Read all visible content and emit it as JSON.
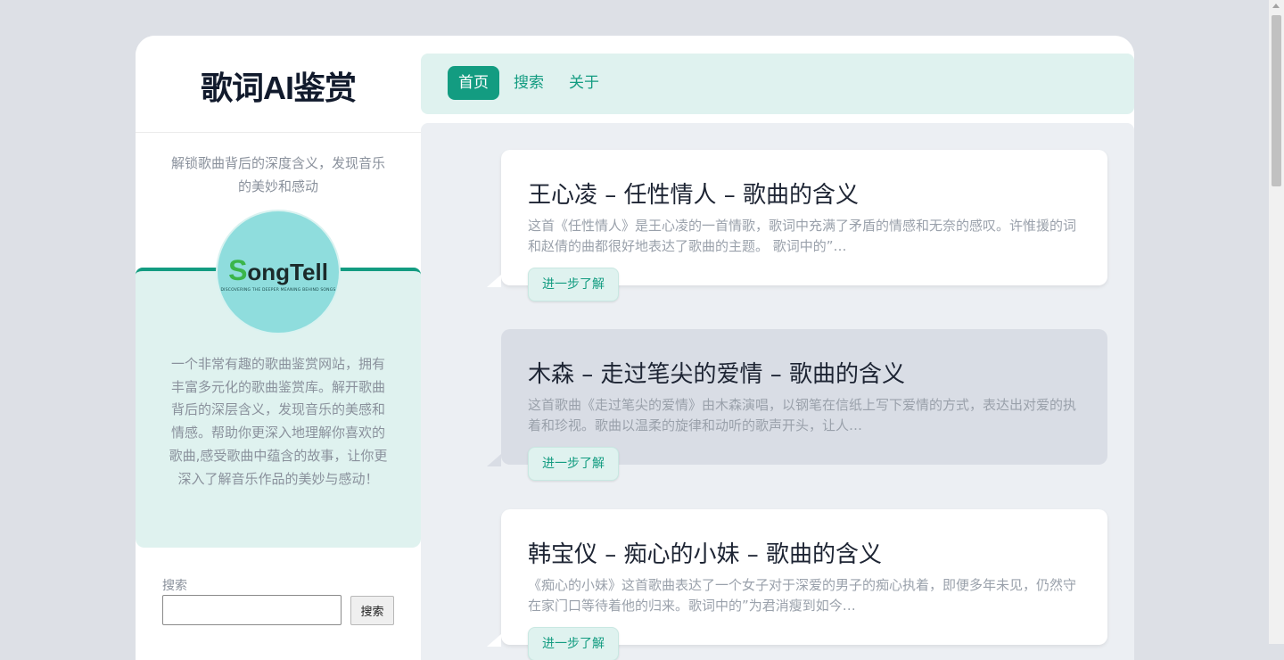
{
  "site": {
    "title": "歌词AI鉴赏",
    "tagline": "解锁歌曲背后的深度含义，发现音乐的美妙和感动",
    "logo_text": "SongTell",
    "logo_subtitle": "DISCOVERING THE DEEPER MEANING BEHIND SONGS",
    "intro": "一个非常有趣的歌曲鉴赏网站，拥有丰富多元化的歌曲鉴赏库。解开歌曲背后的深层含义，发现音乐的美感和情感。帮助你更深入地理解你喜欢的歌曲,感受歌曲中蕴含的故事，让你更深入了解音乐作品的美妙与感动！"
  },
  "search": {
    "label": "搜索",
    "input_value": "",
    "button_label": "搜索"
  },
  "nav": {
    "items": [
      {
        "label": "首页",
        "active": true
      },
      {
        "label": "搜索",
        "active": false
      },
      {
        "label": "关于",
        "active": false
      }
    ]
  },
  "posts": [
    {
      "title": "王心凌 – 任性情人 – 歌曲的含义",
      "excerpt": "这首《任性情人》是王心凌的一首情歌，歌词中充满了矛盾的情感和无奈的感叹。许惟援的词和赵倩的曲都很好地表达了歌曲的主题。 歌词中的”…",
      "more_label": "进一步了解"
    },
    {
      "title": "木森 – 走过笔尖的爱情 – 歌曲的含义",
      "excerpt": "这首歌曲《走过笔尖的爱情》由木森演唱，以钢笔在信纸上写下爱情的方式，表达出对爱的执着和珍视。歌曲以温柔的旋律和动听的歌声开头，让人…",
      "more_label": "进一步了解"
    },
    {
      "title": "韩宝仪 – 痴心的小妹 – 歌曲的含义",
      "excerpt": "《痴心的小妹》这首歌曲表达了一个女子对于深爱的男子的痴心执着，即便多年未见，仍然守在家门口等待着他的归来。歌词中的”为君消瘦到如今…",
      "more_label": "进一步了解"
    }
  ],
  "colors": {
    "accent": "#139c81",
    "accent_light": "#dff2ef",
    "page_bg": "#dde0e6",
    "main_bg": "#eceff3"
  }
}
